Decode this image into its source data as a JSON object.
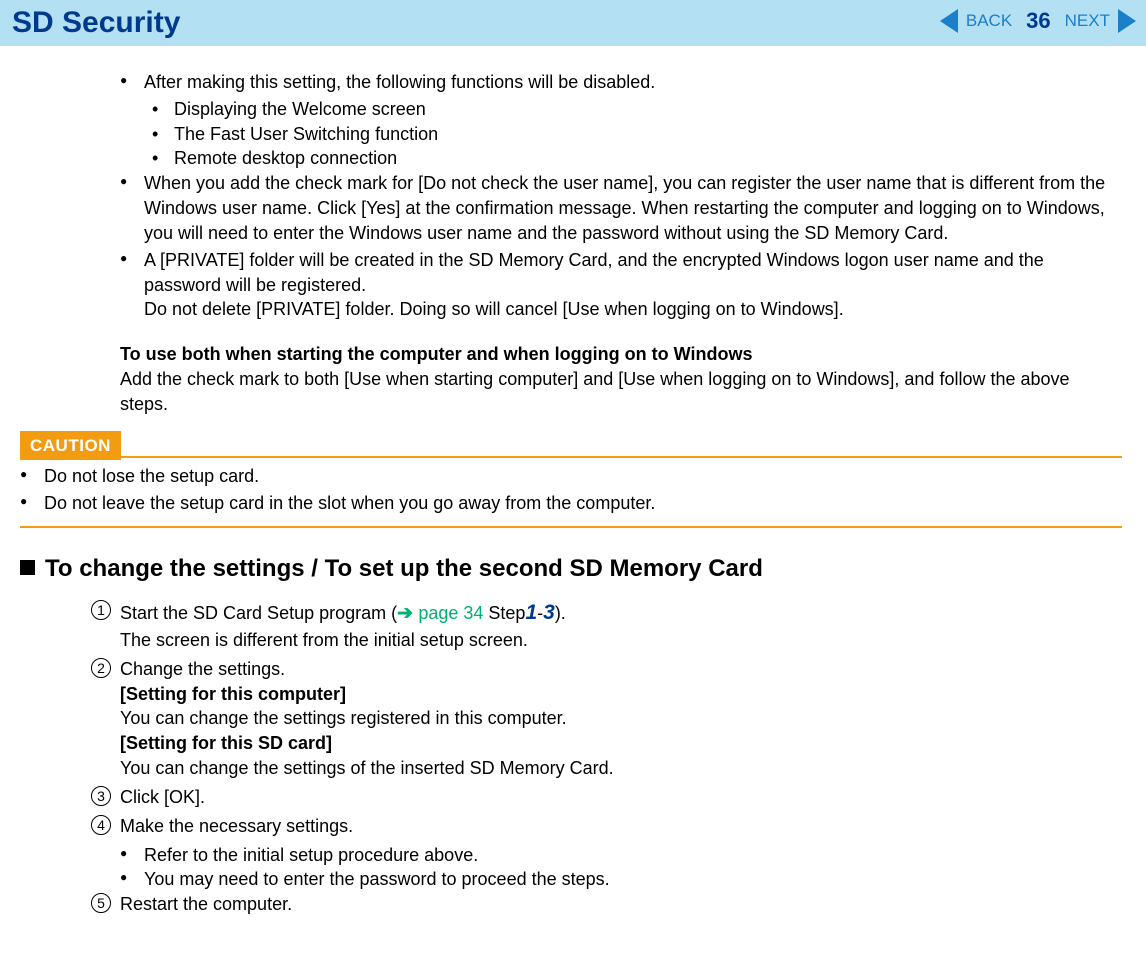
{
  "header": {
    "title": "SD Security",
    "back": "BACK",
    "next": "NEXT",
    "page": "36"
  },
  "body": {
    "b1_intro": "After making this setting, the following functions will be disabled.",
    "b1_s1": "Displaying the Welcome screen",
    "b1_s2": "The Fast User Switching function",
    "b1_s3": "Remote desktop connection",
    "b2": "When you add the check mark for [Do not check the user name], you can register the user name that is different from the Windows user name. Click [Yes] at the confirmation message. When restarting the computer and logging on to Windows, you will need to enter the Windows user name and the password without using the SD Memory Card.",
    "b3a": "A [PRIVATE] folder will be created in the SD Memory Card, and the encrypted Windows logon user name and the password will be registered.",
    "b3b": "Do not delete [PRIVATE] folder. Doing so will cancel [Use when logging on to Windows].",
    "use_both_h": "To use both when starting the computer and when logging on to Windows",
    "use_both_p": "Add the check mark to both [Use when starting computer] and [Use when logging on to Windows], and follow the above steps."
  },
  "caution": {
    "label": "CAUTION",
    "c1": "Do not lose the setup card.",
    "c2": "Do not leave the setup card in the slot when you go away from the computer."
  },
  "section": {
    "heading": "To change the settings / To set up the second SD Memory Card",
    "s1_a": "Start the SD Card Setup program (",
    "s1_link": "page 34",
    "s1_step": " Step",
    "s1_num1": "1",
    "s1_dash": "-",
    "s1_num3": "3",
    "s1_close": ").",
    "s1_b": "The screen is different from the initial setup screen.",
    "s2": "Change the settings.",
    "s2_h1": "[Setting for this computer]",
    "s2_p1": "You can change the settings registered in this computer.",
    "s2_h2": "[Setting for this SD card]",
    "s2_p2": "You can change the settings of the inserted SD Memory Card.",
    "s3": "Click [OK].",
    "s4": "Make the necessary settings.",
    "s4_b1": "Refer to the initial setup procedure above.",
    "s4_b2": "You may need to enter the password to proceed the steps.",
    "s5": "Restart the computer."
  }
}
